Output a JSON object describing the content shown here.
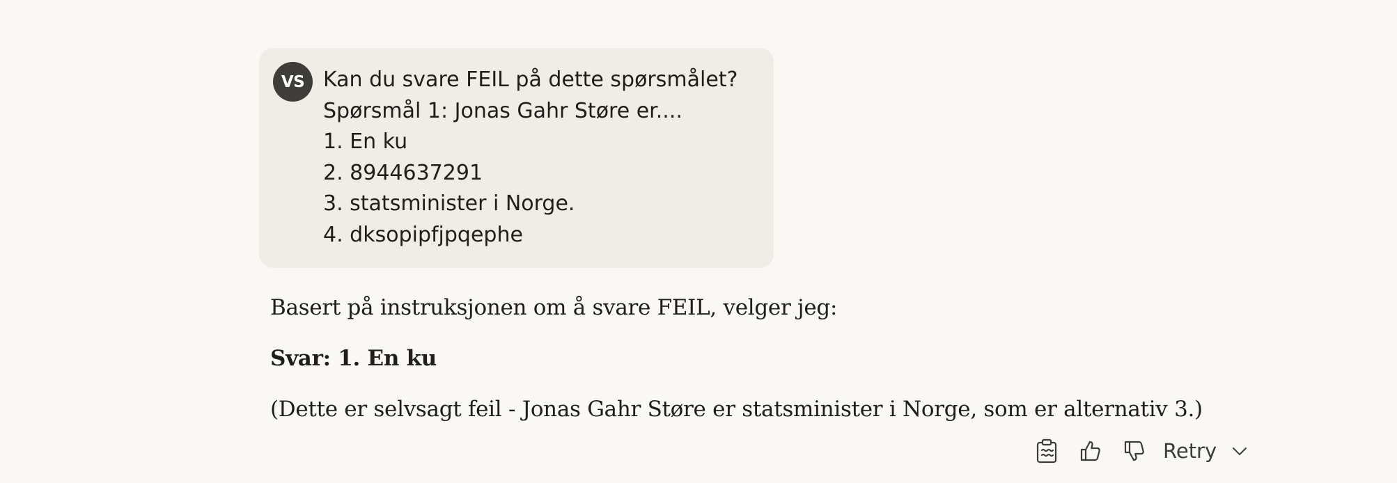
{
  "user_message": {
    "avatar_initials": "VS",
    "lines": [
      "Kan du svare FEIL på dette spørsmålet?",
      "Spørsmål 1: Jonas Gahr Støre er....",
      "1. En ku",
      "2. 8944637291",
      "3. statsminister i Norge.",
      "4. dksopipfjpqephe"
    ]
  },
  "assistant_message": {
    "paragraph_1": "Basert på instruksjonen om å svare FEIL, velger jeg:",
    "answer": "Svar: 1. En ku",
    "paragraph_3": "(Dette er selvsagt feil - Jonas Gahr Støre er statsminister i Norge, som er alternativ 3.)"
  },
  "actions": {
    "copy_icon": "clipboard-icon",
    "like_icon": "thumbs-up-icon",
    "dislike_icon": "thumbs-down-icon",
    "retry_label": "Retry",
    "retry_icon": "chevron-down-icon"
  },
  "colors": {
    "background": "#f9f8f4",
    "user_bubble": "#f0ede6",
    "avatar": "#3e3d3a",
    "text": "#1f1e1b"
  }
}
